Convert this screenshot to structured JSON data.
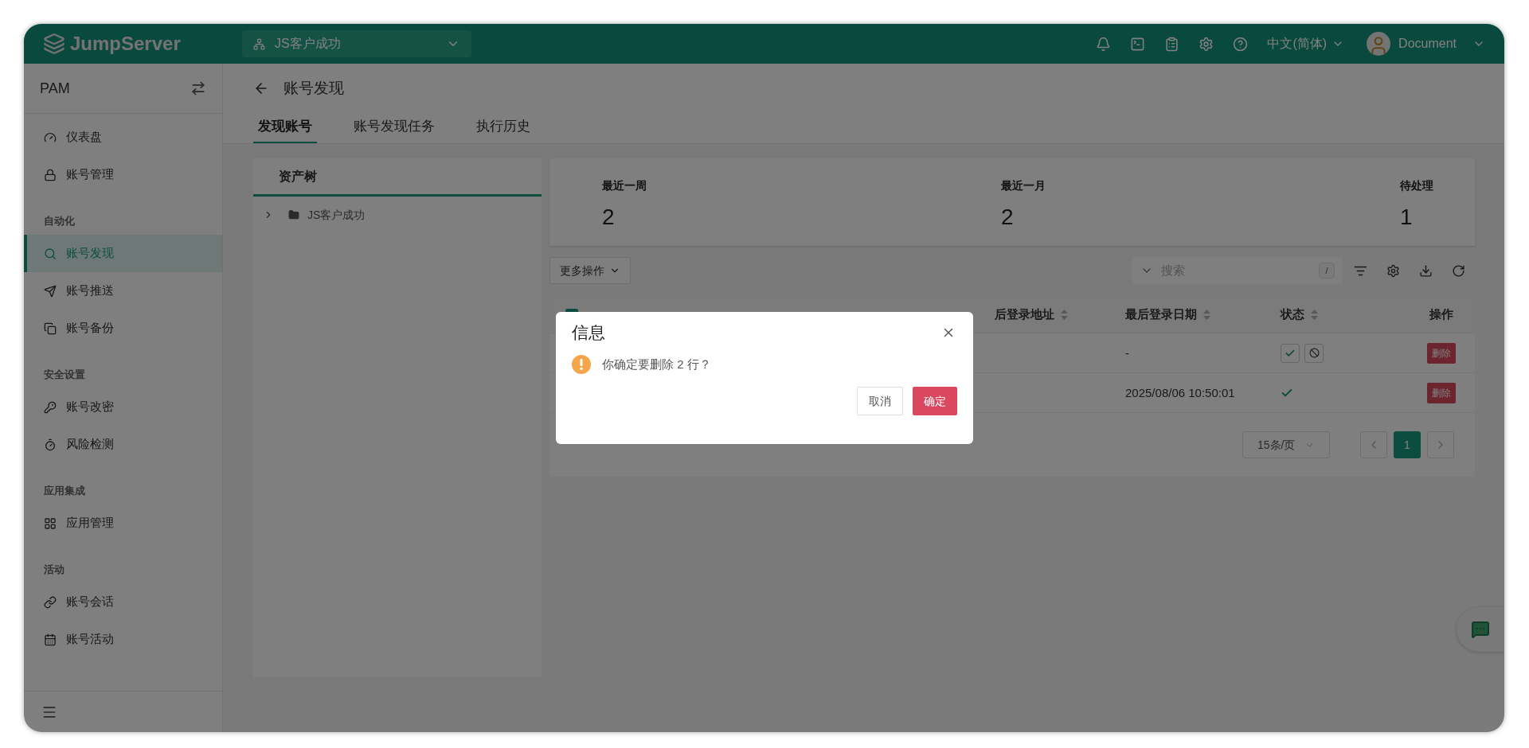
{
  "topbar": {
    "logo": "JumpServer",
    "org": "JS客户成功",
    "language": "中文(简体)",
    "user": "Document"
  },
  "sidebar": {
    "title": "PAM",
    "items": [
      {
        "kind": "item",
        "label": "仪表盘",
        "selected": false
      },
      {
        "kind": "item",
        "label": "账号管理",
        "selected": false
      },
      {
        "kind": "group",
        "label": "自动化"
      },
      {
        "kind": "item",
        "label": "账号发现",
        "selected": true
      },
      {
        "kind": "item",
        "label": "账号推送",
        "selected": false
      },
      {
        "kind": "item",
        "label": "账号备份",
        "selected": false
      },
      {
        "kind": "group",
        "label": "安全设置"
      },
      {
        "kind": "item",
        "label": "账号改密",
        "selected": false
      },
      {
        "kind": "item",
        "label": "风险检测",
        "selected": false
      },
      {
        "kind": "group",
        "label": "应用集成"
      },
      {
        "kind": "item",
        "label": "应用管理",
        "selected": false
      },
      {
        "kind": "group",
        "label": "活动"
      },
      {
        "kind": "item",
        "label": "账号会话",
        "selected": false
      },
      {
        "kind": "item",
        "label": "账号活动",
        "selected": false
      }
    ]
  },
  "page": {
    "title": "账号发现",
    "tabs": [
      {
        "label": "发现账号",
        "selected": true
      },
      {
        "label": "账号发现任务",
        "selected": false
      },
      {
        "label": "执行历史",
        "selected": false
      }
    ]
  },
  "tree": {
    "title": "资产树",
    "nodes": [
      {
        "label": "JS客户成功",
        "expanded": false
      }
    ]
  },
  "stats": [
    {
      "label": "最近一周",
      "value": "2"
    },
    {
      "label": "最近一月",
      "value": "2"
    },
    {
      "label": "待处理",
      "value": "1"
    }
  ],
  "toolbar": {
    "more_actions": "更多操作",
    "search": {
      "placeholder": "搜索",
      "shortcut": "/"
    }
  },
  "table": {
    "select_all": {
      "checked": true
    },
    "columns": [
      {
        "label": "后登录地址",
        "sortable": true
      },
      {
        "label": "最后登录日期",
        "sortable": true
      },
      {
        "label": "状态",
        "sortable": true
      },
      {
        "label": "操作",
        "sortable": false
      }
    ],
    "rows": [
      {
        "last_login_date": "-",
        "status": {
          "kind": "pending"
        },
        "action": "删除"
      },
      {
        "last_login_date": "2025/08/06 10:50:01",
        "status": {
          "kind": "confirmed"
        },
        "action": "删除"
      }
    ]
  },
  "pagination": {
    "page_size": "15条/页",
    "pages": [
      {
        "label": "1",
        "selected": true
      }
    ]
  },
  "dialog": {
    "title": "信息",
    "message": "你确定要删除 2 行？",
    "cancel": "取消",
    "confirm": "确定"
  }
}
